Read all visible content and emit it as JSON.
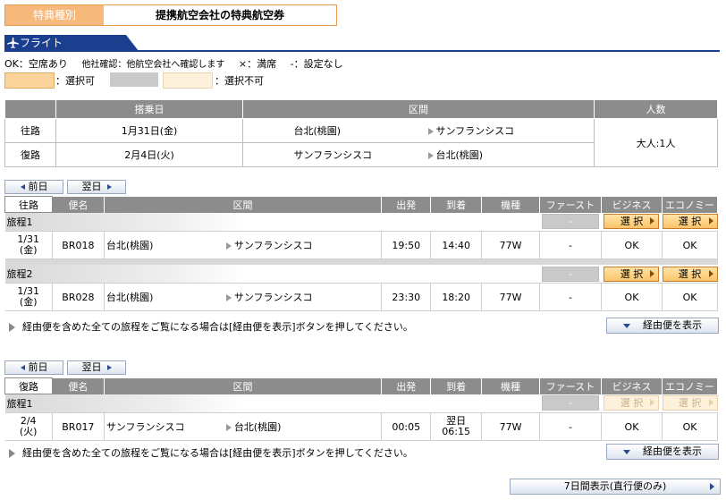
{
  "header": {
    "label": "特典種別",
    "value": "提携航空会社の特典航空券"
  },
  "tab": {
    "label": "フライト"
  },
  "legend": {
    "items": [
      "OK：空席あり",
      "他社確認：他航空会社へ確認します",
      "×：満席",
      "-：設定なし"
    ],
    "selectable": "：選択可",
    "not_selectable": "：選択不可",
    "colors": {
      "selectable": "#fcd39a",
      "gray": "#c9c9c9",
      "not_selectable": "#fdf1dc"
    }
  },
  "summary": {
    "headers": [
      "",
      "搭乗日",
      "区間",
      "人数"
    ],
    "rows": [
      {
        "label": "往路",
        "date": "1月31日(金)",
        "from": "台北(桃園)",
        "to": "サンフランシスコ"
      },
      {
        "label": "復路",
        "date": "2月4日(火)",
        "from": "サンフランシスコ",
        "to": "台北(桃園)"
      }
    ],
    "pax": "大人:1人"
  },
  "nav": {
    "prev": "前日",
    "next": "翌日"
  },
  "outbound": {
    "headers": [
      "往路",
      "便名",
      "区間",
      "出発",
      "到着",
      "機種",
      "ファースト",
      "ビジネス",
      "エコノミー"
    ],
    "trips": [
      {
        "label": "旅程1",
        "first": "-",
        "business_btn": "選 択",
        "economy_btn": "選 択",
        "flight": {
          "date1": "1/31",
          "date2": "(金)",
          "no": "BR018",
          "from": "台北(桃園)",
          "to": "サンフランシスコ",
          "dep": "19:50",
          "arr": "14:40",
          "arr2": "",
          "type": "77W",
          "first": "-",
          "business": "OK",
          "economy": "OK"
        }
      },
      {
        "label": "旅程2",
        "first": "-",
        "business_btn": "選 択",
        "economy_btn": "選 択",
        "flight": {
          "date1": "1/31",
          "date2": "(金)",
          "no": "BR028",
          "from": "台北(桃園)",
          "to": "サンフランシスコ",
          "dep": "23:30",
          "arr": "18:20",
          "arr2": "",
          "type": "77W",
          "first": "-",
          "business": "OK",
          "economy": "OK"
        }
      }
    ],
    "note": "経由便を含めた全ての旅程をご覧になる場合は[経由便を表示]ボタンを押してください。",
    "via_btn": "経由便を表示"
  },
  "inbound": {
    "headers": [
      "復路",
      "便名",
      "区間",
      "出発",
      "到着",
      "機種",
      "ファースト",
      "ビジネス",
      "エコノミー"
    ],
    "trips": [
      {
        "label": "旅程1",
        "first": "-",
        "business_btn": "選 択",
        "economy_btn": "選 択",
        "flight": {
          "date1": "2/4",
          "date2": "(火)",
          "no": "BR017",
          "from": "サンフランシスコ",
          "to": "台北(桃園)",
          "dep": "00:05",
          "arr": "翌日",
          "arr2": "06:15",
          "type": "77W",
          "first": "-",
          "business": "OK",
          "economy": "OK"
        }
      }
    ],
    "note": "経由便を含めた全ての旅程をご覧になる場合は[経由便を表示]ボタンを押してください。",
    "via_btn": "経由便を表示"
  },
  "week_btn": "7日間表示(直行便のみ)"
}
